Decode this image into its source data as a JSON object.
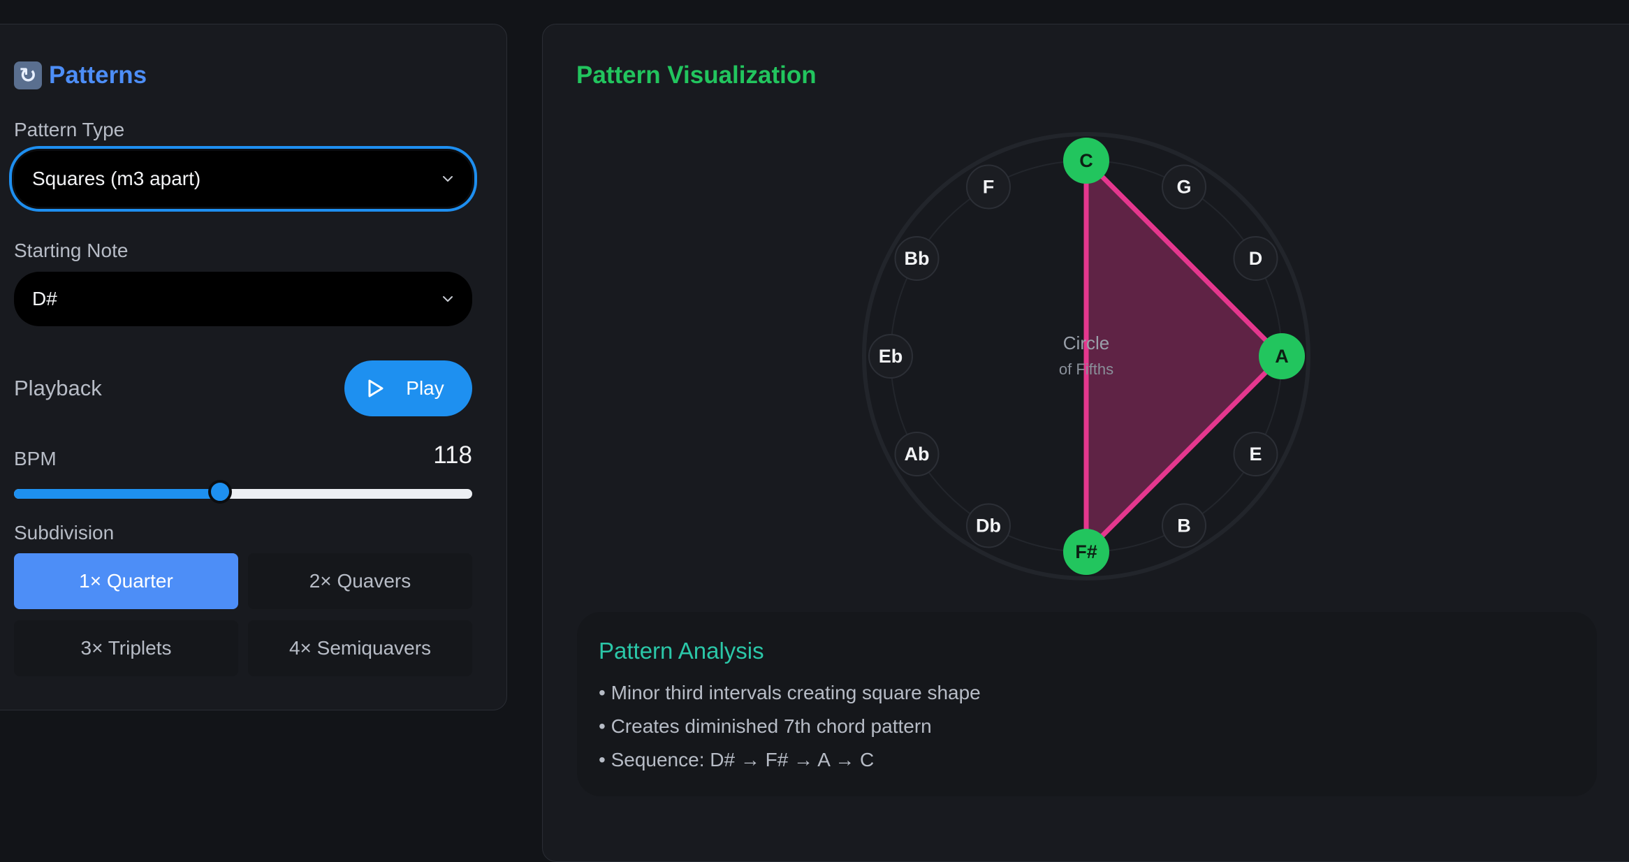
{
  "left_panel": {
    "title": "Patterns",
    "pattern_type_label": "Pattern Type",
    "pattern_type_value": "Squares (m3 apart)",
    "starting_note_label": "Starting Note",
    "starting_note_value": "D#",
    "playback_label": "Playback",
    "play_label": "Play",
    "bpm_label": "BPM",
    "bpm_value": "118",
    "bpm_slider_fraction": 0.45,
    "subdivision_label": "Subdivision",
    "subdivisions": [
      {
        "label": "1× Quarter",
        "active": true
      },
      {
        "label": "2× Quavers",
        "active": false
      },
      {
        "label": "3× Triplets",
        "active": false
      },
      {
        "label": "4× Semiquavers",
        "active": false
      }
    ]
  },
  "visualization": {
    "title": "Pattern Visualization",
    "center_line1": "Circle",
    "center_line2": "of Fifths",
    "notes": [
      "C",
      "G",
      "D",
      "A",
      "E",
      "B",
      "F#",
      "Db",
      "Ab",
      "Eb",
      "Bb",
      "F"
    ],
    "highlighted_notes": [
      "C",
      "A",
      "F#"
    ],
    "highlight_color": "#22c55e",
    "shape_color": "#e5378e"
  },
  "analysis": {
    "title": "Pattern Analysis",
    "items": [
      "• Minor third intervals creating square shape",
      "• Creates diminished 7th chord pattern",
      "• Sequence: D# → F# → A → C"
    ]
  },
  "colors": {
    "accent_blue": "#1e90f0",
    "title_blue": "#4d8ef7",
    "green": "#22c55e",
    "teal": "#2bc7a8"
  }
}
